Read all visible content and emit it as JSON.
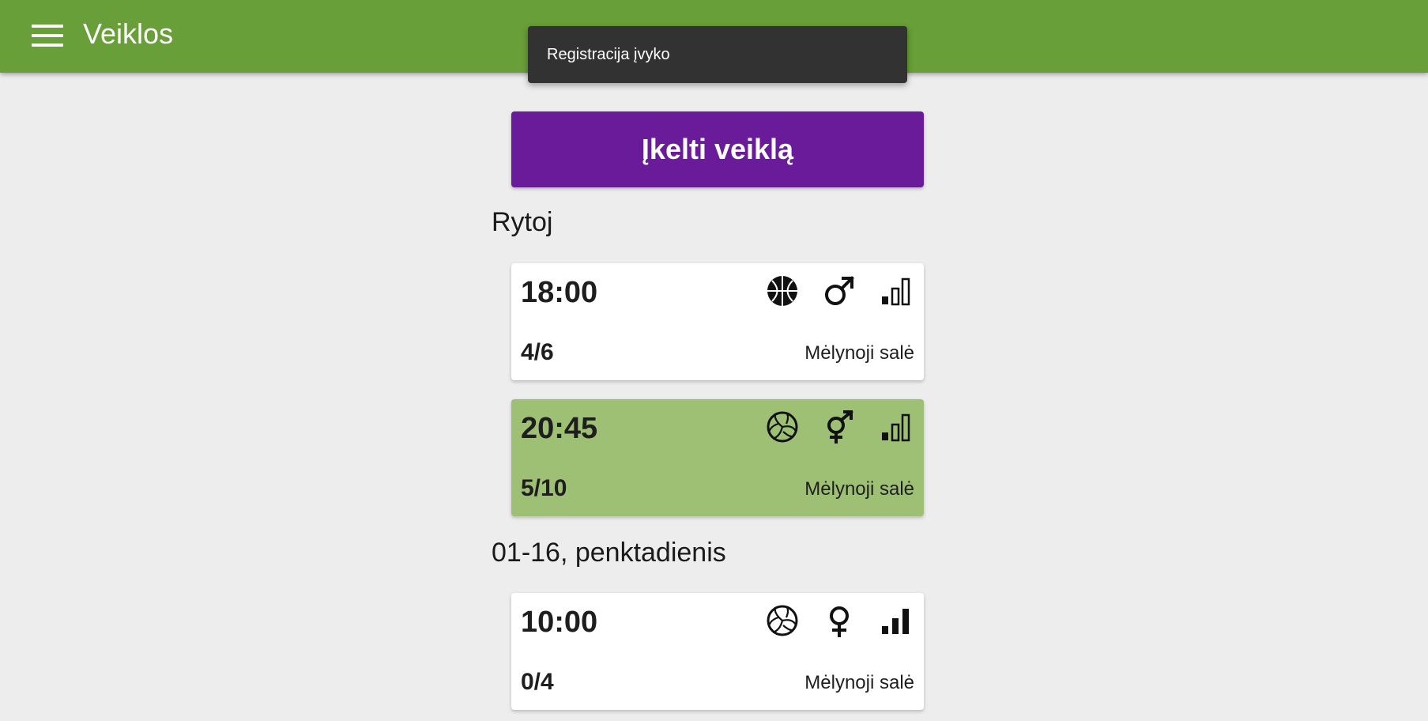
{
  "header": {
    "title": "Veiklos",
    "menu_icon": "menu-icon",
    "color": "#689f38"
  },
  "snackbar": {
    "message": "Registracija įvyko"
  },
  "upload_button": {
    "label": "Įkelti veiklą",
    "color": "#6a1b9a"
  },
  "sections": [
    {
      "title": "Rytoj",
      "activities": [
        {
          "time": "18:00",
          "count": "4/6",
          "place": "Mėlynoji salė",
          "sport_icon": "basketball-icon",
          "gender_icon": "male-icon",
          "level_icon": "level-low-icon",
          "selected": false
        },
        {
          "time": "20:45",
          "count": "5/10",
          "place": "Mėlynoji salė",
          "sport_icon": "volleyball-icon",
          "gender_icon": "mixed-gender-icon",
          "level_icon": "level-low-icon",
          "selected": true
        }
      ]
    },
    {
      "title": "01-16, penktadienis",
      "activities": [
        {
          "time": "10:00",
          "count": "0/4",
          "place": "Mėlynoji salė",
          "sport_icon": "volleyball-icon",
          "gender_icon": "female-icon",
          "level_icon": "level-high-icon",
          "selected": false
        }
      ]
    }
  ],
  "colors": {
    "selected_card": "#9ec074",
    "background": "#ededed"
  }
}
